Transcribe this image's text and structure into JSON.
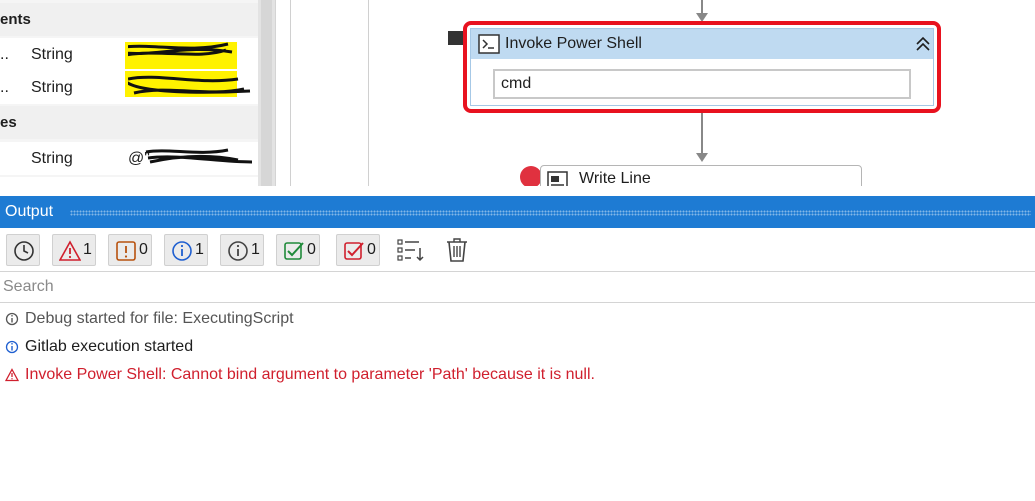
{
  "variables": {
    "group_arguments": "ents",
    "group_variables": "es",
    "rows": [
      {
        "dots": "..",
        "type": "String",
        "value": ""
      },
      {
        "dots": "..",
        "type": "String",
        "value": ""
      },
      {
        "dots": "",
        "type": "String",
        "value": "@\""
      }
    ]
  },
  "designer": {
    "invoke": {
      "title": "Invoke Power Shell",
      "command": "cmd"
    },
    "write_line": {
      "title": "Write Line"
    }
  },
  "output": {
    "title": "Output",
    "filters": {
      "errors": "1",
      "warnings": "0",
      "info": "1",
      "trace": "1",
      "success": "0",
      "failed": "0"
    },
    "search_placeholder": "Search",
    "log": [
      {
        "level": "trace",
        "text": "Debug started for file: ExecutingScript"
      },
      {
        "level": "info",
        "text": "Gitlab execution started"
      },
      {
        "level": "error",
        "text": "Invoke Power Shell: Cannot bind argument to parameter 'Path' because it is null."
      }
    ]
  },
  "colors": {
    "panel_header": "#1e7bd3",
    "error_text": "#d0202e",
    "selection_border": "#e8121f",
    "activity_header": "#bfdaf1"
  }
}
